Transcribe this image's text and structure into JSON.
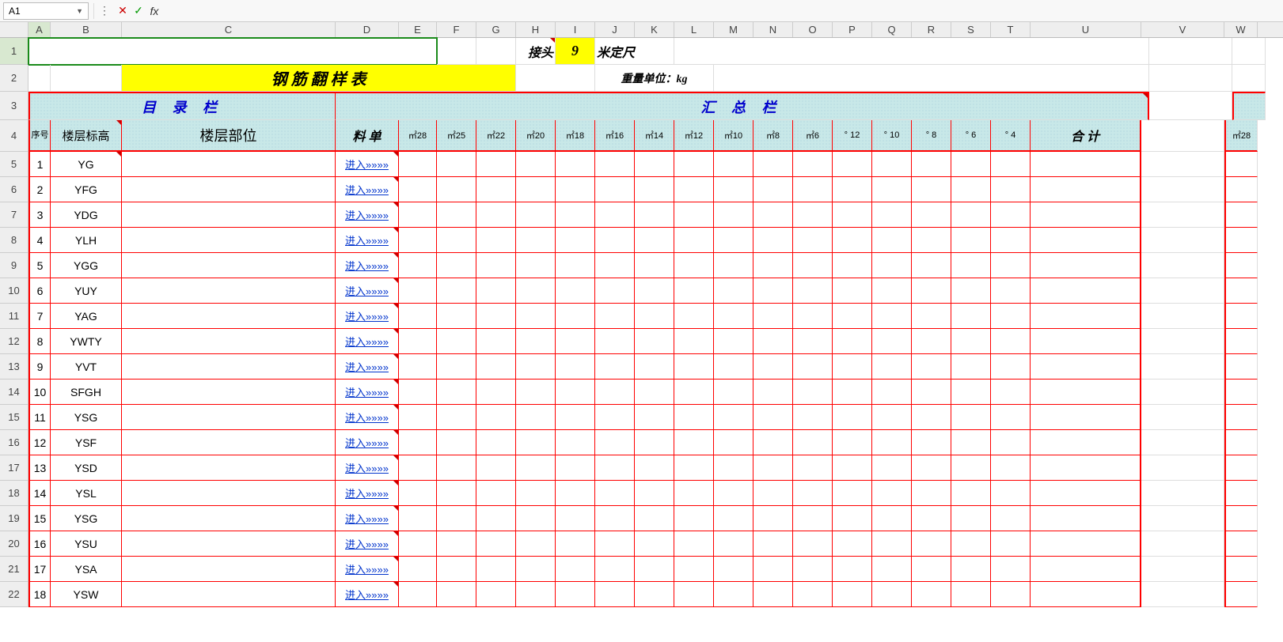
{
  "formula_bar": {
    "cell_ref": "A1",
    "value": ""
  },
  "columns": [
    "A",
    "B",
    "C",
    "D",
    "E",
    "F",
    "G",
    "H",
    "I",
    "J",
    "K",
    "L",
    "M",
    "N",
    "O",
    "P",
    "Q",
    "R",
    "S",
    "T",
    "U",
    "V",
    "W"
  ],
  "row1": {
    "jietou": "接头",
    "val": "9",
    "suffix": "米定尺"
  },
  "row2": {
    "title": "钢 筋 翻 样 表",
    "unit": "重量单位：kg"
  },
  "row3": {
    "left": "目   录   栏",
    "right": "汇       总       栏"
  },
  "row4": {
    "seq": "序号",
    "biaogao": "楼层标高",
    "buwei": "楼层部位",
    "liaodan": "料 单",
    "cols": [
      "㎡28",
      "㎡25",
      "㎡22",
      "㎡20",
      "㎡18",
      "㎡16",
      "㎡14",
      "㎡12",
      "㎡10",
      "㎡8",
      "㎡6",
      "° 12",
      "° 10",
      "° 8",
      "° 6",
      "° 4"
    ],
    "heji": "合 计",
    "far": "㎡28"
  },
  "data_rows": [
    {
      "n": "1",
      "code": "YG"
    },
    {
      "n": "2",
      "code": "YFG"
    },
    {
      "n": "3",
      "code": "YDG"
    },
    {
      "n": "4",
      "code": "YLH"
    },
    {
      "n": "5",
      "code": "YGG"
    },
    {
      "n": "6",
      "code": "YUY"
    },
    {
      "n": "7",
      "code": "YAG"
    },
    {
      "n": "8",
      "code": "YWTY"
    },
    {
      "n": "9",
      "code": "YVT"
    },
    {
      "n": "10",
      "code": "SFGH"
    },
    {
      "n": "11",
      "code": "YSG"
    },
    {
      "n": "12",
      "code": "YSF"
    },
    {
      "n": "13",
      "code": "YSD"
    },
    {
      "n": "14",
      "code": "YSL"
    },
    {
      "n": "15",
      "code": "YSG"
    },
    {
      "n": "16",
      "code": "YSU"
    },
    {
      "n": "17",
      "code": "YSA"
    },
    {
      "n": "18",
      "code": "YSW"
    }
  ],
  "enter_link": "进入»»»»"
}
